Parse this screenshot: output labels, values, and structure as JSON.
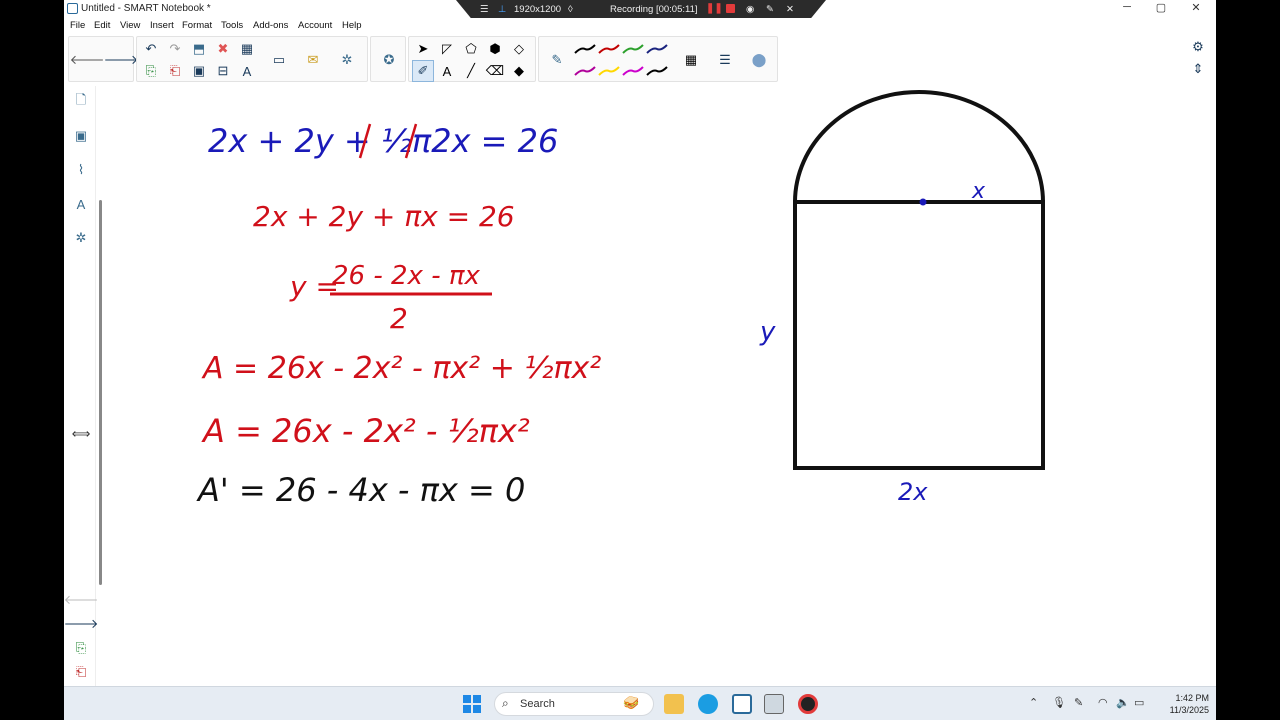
{
  "window": {
    "title": "Untitled - SMART Notebook *",
    "controls": {
      "minimize": "─",
      "maximize": "▢",
      "close": "✕"
    }
  },
  "recording_bar": {
    "resolution": "1920x1200",
    "status": "Recording [00:05:11]"
  },
  "menu": [
    "File",
    "Edit",
    "View",
    "Insert",
    "Format",
    "Tools",
    "Add-ons",
    "Account",
    "Help"
  ],
  "toolbar": {
    "pens": [
      {
        "color": "#000000"
      },
      {
        "color": "#c00000"
      },
      {
        "color": "#2ca02c"
      },
      {
        "color": "#1a237e"
      },
      {
        "color": "#b0009a"
      },
      {
        "color": "#ffd800"
      },
      {
        "color": "#cc00cc"
      },
      {
        "color": "#000000"
      }
    ]
  },
  "canvas": {
    "equations": {
      "eq1": "2x + 2y + ½π2x = 26",
      "eq2": "2x + 2y + πx = 26",
      "eq3_lhs": "y =",
      "eq3_num": "26 - 2x - πx",
      "eq3_den": "2",
      "eq4": "A = 26x - 2x² - πx² + ½πx²",
      "eq5": "A = 26x - 2x² - ½πx²",
      "eq6": "A' = 26 - 4x - πx = 0"
    },
    "figure_labels": {
      "radius": "x",
      "height": "y",
      "base": "2x"
    },
    "colors": {
      "blue": "#1a1ab8",
      "red": "#d0101a",
      "black": "#111111"
    }
  },
  "taskbar": {
    "search_label": "Search",
    "time": "1:42 PM",
    "date": "11/3/2025"
  }
}
